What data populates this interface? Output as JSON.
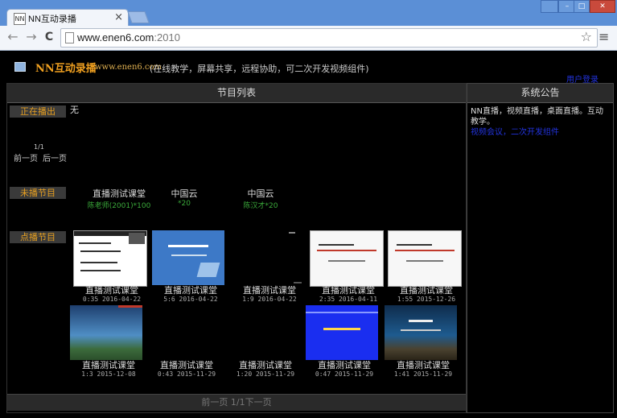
{
  "browser": {
    "tab_title": "NN互动录播",
    "tab_favicon": "NN",
    "close_glyph": "×",
    "win_minimize": "–",
    "win_restore": "□",
    "win_close": "✕",
    "url_host": "www.enen6.com",
    "url_port": ":2010",
    "back_glyph": "←",
    "forward_glyph": "→",
    "reload_glyph": "C",
    "star_glyph": "☆",
    "menu_glyph": "≡"
  },
  "header": {
    "title": "NN互动录播",
    "domain": "www.enen6.com",
    "description": "(在线教学，屏幕共享，远程协助，可二次开发视频组件)",
    "login_link": "用户登录"
  },
  "main": {
    "heading": "节目列表",
    "live_label": "正在播出",
    "live_value": "无",
    "pager_number": "1/1",
    "pager_prev": "前一页",
    "pager_next": "后一页",
    "upcoming_label": "未播节目",
    "upcoming": [
      {
        "title": "直播测试课堂",
        "subtitle": "陈老师(2001)*100"
      },
      {
        "title": "中国云",
        "subtitle": "*20"
      },
      {
        "title": "中国云",
        "subtitle": "陈汉才*20"
      }
    ],
    "vod_label": "点播节目",
    "vod": [
      {
        "title": "直播测试课堂",
        "meta": "0:35 2016-04-22",
        "thumb_style": "doc"
      },
      {
        "title": "直播测试课堂",
        "meta": "5:6 2016-04-22",
        "thumb_style": "blue"
      },
      {
        "title": "直播测试课堂",
        "meta": "1:9 2016-04-22",
        "thumb_style": "dark"
      },
      {
        "title": "直播测试课堂",
        "meta": "2:35 2016-04-11",
        "thumb_style": "white-red"
      },
      {
        "title": "直播测试课堂",
        "meta": "1:55 2015-12-26",
        "thumb_style": "white-red"
      },
      {
        "title": "直播测试课堂",
        "meta": "1:3 2015-12-08",
        "thumb_style": "sky"
      },
      {
        "title": "直播测试课堂",
        "meta": "0:43 2015-11-29",
        "thumb_style": "dark"
      },
      {
        "title": "直播测试课堂",
        "meta": "1:20 2015-11-29",
        "thumb_style": "dark"
      },
      {
        "title": "直播测试课堂",
        "meta": "0:47 2015-11-29",
        "thumb_style": "deepblue"
      },
      {
        "title": "直播测试课堂",
        "meta": "1:41 2015-11-29",
        "thumb_style": "mountain"
      }
    ],
    "footer_pager": "前一页 1/1下一页"
  },
  "sidebar": {
    "heading": "系统公告",
    "notice": "NN直播，视频直播，桌面直播。互动教学。",
    "notice_link": "视频会议，二次开发组件"
  }
}
